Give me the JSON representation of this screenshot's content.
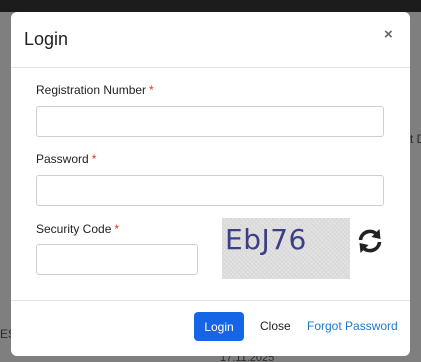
{
  "background": {
    "right_text": "t D",
    "left_text": "ES",
    "bottom_text": "17.11.2025"
  },
  "modal": {
    "title": "Login",
    "close_symbol": "×",
    "fields": {
      "registration": {
        "label": "Registration Number",
        "required_mark": "*",
        "value": ""
      },
      "password": {
        "label": "Password",
        "required_mark": "*",
        "value": ""
      },
      "security": {
        "label": "Security Code",
        "required_mark": "*",
        "value": ""
      }
    },
    "captcha": {
      "text": "EbJ76",
      "refresh_icon": "refresh-icon"
    },
    "footer": {
      "login_label": "Login",
      "close_label": "Close",
      "forgot_label": "Forgot Password"
    }
  },
  "colors": {
    "primary": "#1565e6",
    "link": "#1f78d1",
    "required": "#d9342b",
    "captcha_text": "#3b3f84"
  }
}
